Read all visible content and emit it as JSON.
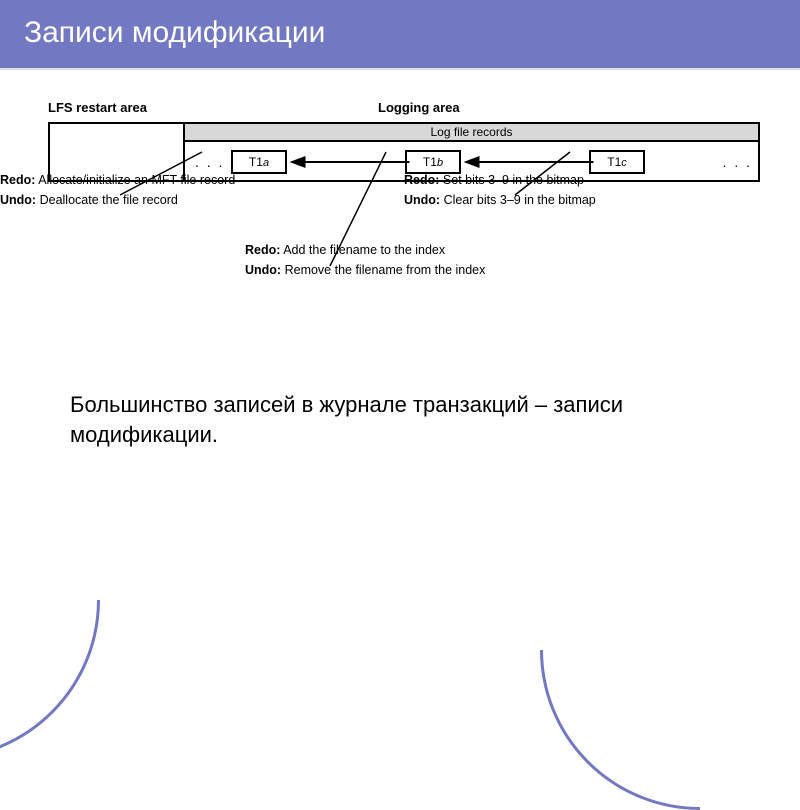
{
  "title": "Записи модификации",
  "legend": {
    "lfs": "LFS restart area",
    "log": "Logging area"
  },
  "records_header": "Log file records",
  "records": {
    "a": {
      "prefix": "T1",
      "sub": "a"
    },
    "b": {
      "prefix": "T1",
      "sub": "b"
    },
    "c": {
      "prefix": "T1",
      "sub": "c"
    }
  },
  "ellipsis": ". . .",
  "annot": {
    "a_redo_label": "Redo:",
    "a_redo": "Allocate/initialize an MFT file record",
    "a_undo_label": "Undo:",
    "a_undo": "Deallocate the file record",
    "b_redo_label": "Redo:",
    "b_redo": "Add the filename to the index",
    "b_undo_label": "Undo:",
    "b_undo": "Remove the filename from the index",
    "c_redo_label": "Redo:",
    "c_redo": "Set bits 3–9 in the bitmap",
    "c_undo_label": "Undo:",
    "c_undo": "Clear bits 3–9 in the bitmap"
  },
  "body_text": "Большинство записей в журнале транзакций – записи модификации."
}
